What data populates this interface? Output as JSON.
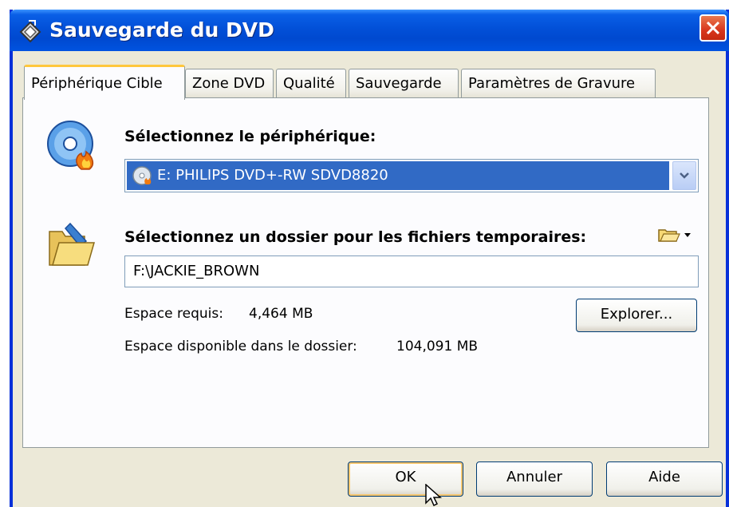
{
  "window": {
    "title": "Sauvegarde du DVD"
  },
  "tabs": [
    {
      "label": "Périphérique Cible"
    },
    {
      "label": "Zone DVD"
    },
    {
      "label": "Qualité"
    },
    {
      "label": "Sauvegarde"
    },
    {
      "label": "Paramètres de Gravure"
    }
  ],
  "device": {
    "label": "Sélectionnez le périphérique:",
    "selected": "E: PHILIPS  DVD+-RW SDVD8820"
  },
  "temp_folder": {
    "label": "Sélectionnez un dossier pour les fichiers temporaires:",
    "value": "F:\\JACKIE_BROWN",
    "browse_label": "Explorer...",
    "space_required_label": "Espace requis:",
    "space_required_value": "4,464 MB",
    "space_available_label": "Espace disponible dans le dossier:",
    "space_available_value": "104,091 MB"
  },
  "buttons": {
    "ok": "OK",
    "cancel": "Annuler",
    "help": "Aide"
  },
  "icons": {
    "title": "dvd-backup-icon",
    "close": "close-icon",
    "device": "cd-burn-icon",
    "folder": "open-folder-icon",
    "folder_menu": "folder-dropdown-icon",
    "cursor": "mouse-pointer-icon"
  },
  "colors": {
    "titlebar": "#0054e3",
    "selection": "#316ac5",
    "active_tab": "#ffc73c",
    "dialog_bg": "#ece9d8"
  }
}
